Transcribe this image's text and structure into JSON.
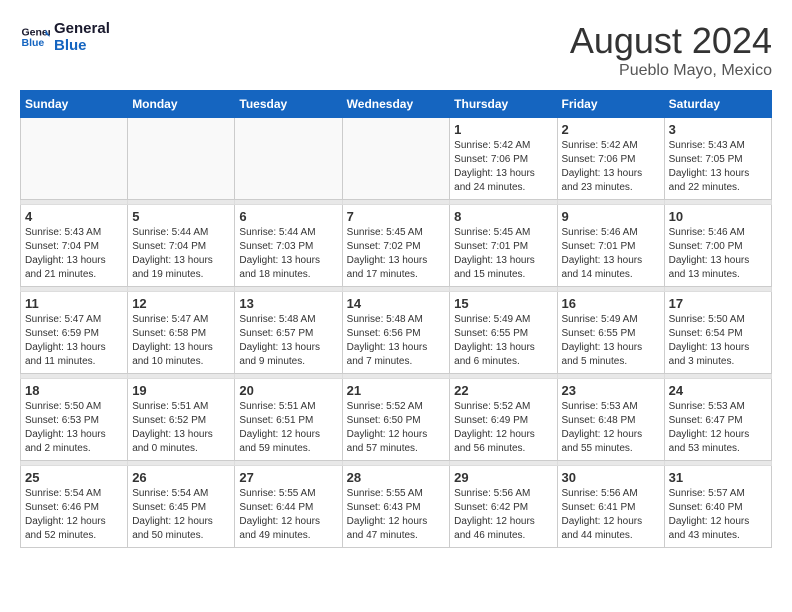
{
  "header": {
    "logo_line1": "General",
    "logo_line2": "Blue",
    "month_title": "August 2024",
    "location": "Pueblo Mayo, Mexico"
  },
  "days_of_week": [
    "Sunday",
    "Monday",
    "Tuesday",
    "Wednesday",
    "Thursday",
    "Friday",
    "Saturday"
  ],
  "weeks": [
    [
      {
        "num": "",
        "info": ""
      },
      {
        "num": "",
        "info": ""
      },
      {
        "num": "",
        "info": ""
      },
      {
        "num": "",
        "info": ""
      },
      {
        "num": "1",
        "info": "Sunrise: 5:42 AM\nSunset: 7:06 PM\nDaylight: 13 hours\nand 24 minutes."
      },
      {
        "num": "2",
        "info": "Sunrise: 5:42 AM\nSunset: 7:06 PM\nDaylight: 13 hours\nand 23 minutes."
      },
      {
        "num": "3",
        "info": "Sunrise: 5:43 AM\nSunset: 7:05 PM\nDaylight: 13 hours\nand 22 minutes."
      }
    ],
    [
      {
        "num": "4",
        "info": "Sunrise: 5:43 AM\nSunset: 7:04 PM\nDaylight: 13 hours\nand 21 minutes."
      },
      {
        "num": "5",
        "info": "Sunrise: 5:44 AM\nSunset: 7:04 PM\nDaylight: 13 hours\nand 19 minutes."
      },
      {
        "num": "6",
        "info": "Sunrise: 5:44 AM\nSunset: 7:03 PM\nDaylight: 13 hours\nand 18 minutes."
      },
      {
        "num": "7",
        "info": "Sunrise: 5:45 AM\nSunset: 7:02 PM\nDaylight: 13 hours\nand 17 minutes."
      },
      {
        "num": "8",
        "info": "Sunrise: 5:45 AM\nSunset: 7:01 PM\nDaylight: 13 hours\nand 15 minutes."
      },
      {
        "num": "9",
        "info": "Sunrise: 5:46 AM\nSunset: 7:01 PM\nDaylight: 13 hours\nand 14 minutes."
      },
      {
        "num": "10",
        "info": "Sunrise: 5:46 AM\nSunset: 7:00 PM\nDaylight: 13 hours\nand 13 minutes."
      }
    ],
    [
      {
        "num": "11",
        "info": "Sunrise: 5:47 AM\nSunset: 6:59 PM\nDaylight: 13 hours\nand 11 minutes."
      },
      {
        "num": "12",
        "info": "Sunrise: 5:47 AM\nSunset: 6:58 PM\nDaylight: 13 hours\nand 10 minutes."
      },
      {
        "num": "13",
        "info": "Sunrise: 5:48 AM\nSunset: 6:57 PM\nDaylight: 13 hours\nand 9 minutes."
      },
      {
        "num": "14",
        "info": "Sunrise: 5:48 AM\nSunset: 6:56 PM\nDaylight: 13 hours\nand 7 minutes."
      },
      {
        "num": "15",
        "info": "Sunrise: 5:49 AM\nSunset: 6:55 PM\nDaylight: 13 hours\nand 6 minutes."
      },
      {
        "num": "16",
        "info": "Sunrise: 5:49 AM\nSunset: 6:55 PM\nDaylight: 13 hours\nand 5 minutes."
      },
      {
        "num": "17",
        "info": "Sunrise: 5:50 AM\nSunset: 6:54 PM\nDaylight: 13 hours\nand 3 minutes."
      }
    ],
    [
      {
        "num": "18",
        "info": "Sunrise: 5:50 AM\nSunset: 6:53 PM\nDaylight: 13 hours\nand 2 minutes."
      },
      {
        "num": "19",
        "info": "Sunrise: 5:51 AM\nSunset: 6:52 PM\nDaylight: 13 hours\nand 0 minutes."
      },
      {
        "num": "20",
        "info": "Sunrise: 5:51 AM\nSunset: 6:51 PM\nDaylight: 12 hours\nand 59 minutes."
      },
      {
        "num": "21",
        "info": "Sunrise: 5:52 AM\nSunset: 6:50 PM\nDaylight: 12 hours\nand 57 minutes."
      },
      {
        "num": "22",
        "info": "Sunrise: 5:52 AM\nSunset: 6:49 PM\nDaylight: 12 hours\nand 56 minutes."
      },
      {
        "num": "23",
        "info": "Sunrise: 5:53 AM\nSunset: 6:48 PM\nDaylight: 12 hours\nand 55 minutes."
      },
      {
        "num": "24",
        "info": "Sunrise: 5:53 AM\nSunset: 6:47 PM\nDaylight: 12 hours\nand 53 minutes."
      }
    ],
    [
      {
        "num": "25",
        "info": "Sunrise: 5:54 AM\nSunset: 6:46 PM\nDaylight: 12 hours\nand 52 minutes."
      },
      {
        "num": "26",
        "info": "Sunrise: 5:54 AM\nSunset: 6:45 PM\nDaylight: 12 hours\nand 50 minutes."
      },
      {
        "num": "27",
        "info": "Sunrise: 5:55 AM\nSunset: 6:44 PM\nDaylight: 12 hours\nand 49 minutes."
      },
      {
        "num": "28",
        "info": "Sunrise: 5:55 AM\nSunset: 6:43 PM\nDaylight: 12 hours\nand 47 minutes."
      },
      {
        "num": "29",
        "info": "Sunrise: 5:56 AM\nSunset: 6:42 PM\nDaylight: 12 hours\nand 46 minutes."
      },
      {
        "num": "30",
        "info": "Sunrise: 5:56 AM\nSunset: 6:41 PM\nDaylight: 12 hours\nand 44 minutes."
      },
      {
        "num": "31",
        "info": "Sunrise: 5:57 AM\nSunset: 6:40 PM\nDaylight: 12 hours\nand 43 minutes."
      }
    ]
  ]
}
